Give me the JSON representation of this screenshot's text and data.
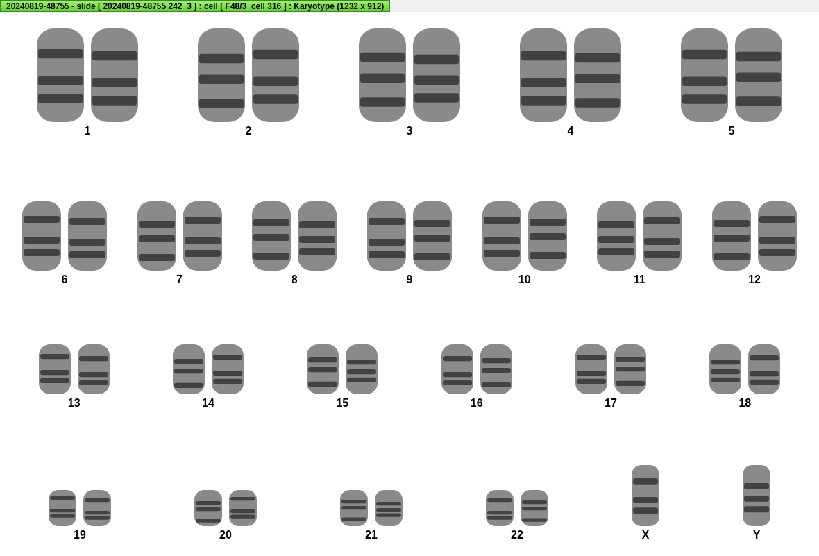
{
  "title": "20240819-48755 - slide [ 20240819-48755 242_3 ] : cell [ F48/3_cell 316 ] : Karyotype  (1232 x 912)",
  "rows": [
    [
      {
        "label": "1",
        "kind": "pair"
      },
      {
        "label": "2",
        "kind": "pair"
      },
      {
        "label": "3",
        "kind": "pair"
      },
      {
        "label": "4",
        "kind": "pair"
      },
      {
        "label": "5",
        "kind": "pair"
      }
    ],
    [
      {
        "label": "6",
        "kind": "pair"
      },
      {
        "label": "7",
        "kind": "pair"
      },
      {
        "label": "8",
        "kind": "pair"
      },
      {
        "label": "9",
        "kind": "pair"
      },
      {
        "label": "10",
        "kind": "pair"
      },
      {
        "label": "11",
        "kind": "pair"
      },
      {
        "label": "12",
        "kind": "pair"
      }
    ],
    [
      {
        "label": "13",
        "kind": "pair"
      },
      {
        "label": "14",
        "kind": "pair"
      },
      {
        "label": "15",
        "kind": "pair"
      },
      {
        "label": "16",
        "kind": "pair"
      },
      {
        "label": "17",
        "kind": "pair"
      },
      {
        "label": "18",
        "kind": "pair"
      }
    ],
    [
      {
        "label": "19",
        "kind": "pair"
      },
      {
        "label": "20",
        "kind": "pair"
      },
      {
        "label": "21",
        "kind": "pair"
      },
      {
        "label": "22",
        "kind": "pair"
      },
      {
        "label": "X",
        "kind": "single"
      },
      {
        "label": "Y",
        "kind": "single"
      }
    ]
  ]
}
